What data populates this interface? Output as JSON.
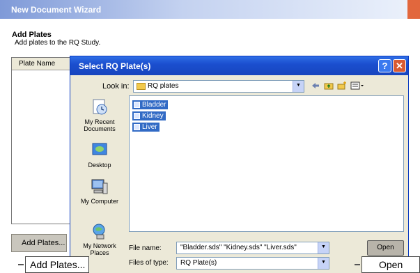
{
  "wizard": {
    "title": "New Document Wizard",
    "heading": "Add Plates",
    "subtitle": "Add plates to the RQ Study.",
    "column_header": "Plate Name",
    "add_plates_button": "Add Plates..."
  },
  "dialog": {
    "title": "Select RQ Plate(s)",
    "help_label": "?",
    "close_label": "✕",
    "look_in_label": "Look in:",
    "look_in_value": "RQ plates",
    "places": [
      {
        "label": "My Recent Documents"
      },
      {
        "label": "Desktop"
      },
      {
        "label": "My Computer"
      },
      {
        "label": "My Network Places"
      }
    ],
    "files": [
      {
        "name": "Bladder"
      },
      {
        "name": "Kidney"
      },
      {
        "name": "Liver"
      }
    ],
    "file_name_label": "File name:",
    "file_name_value": "\"Bladder.sds\" \"Kidney.sds\" \"Liver.sds\"",
    "files_of_type_label": "Files of type:",
    "files_of_type_value": "RQ Plate(s)",
    "open_button": "Open"
  },
  "callouts": {
    "add_plates": "Add Plates...",
    "open": "Open"
  },
  "icons": {
    "back": "back-arrow-icon",
    "up": "up-folder-icon",
    "new_folder": "new-folder-icon",
    "views": "views-menu-icon"
  },
  "colors": {
    "dialog_titlebar": "#1b4fcf",
    "selection": "#316ac5",
    "close_button": "#d95b33"
  }
}
